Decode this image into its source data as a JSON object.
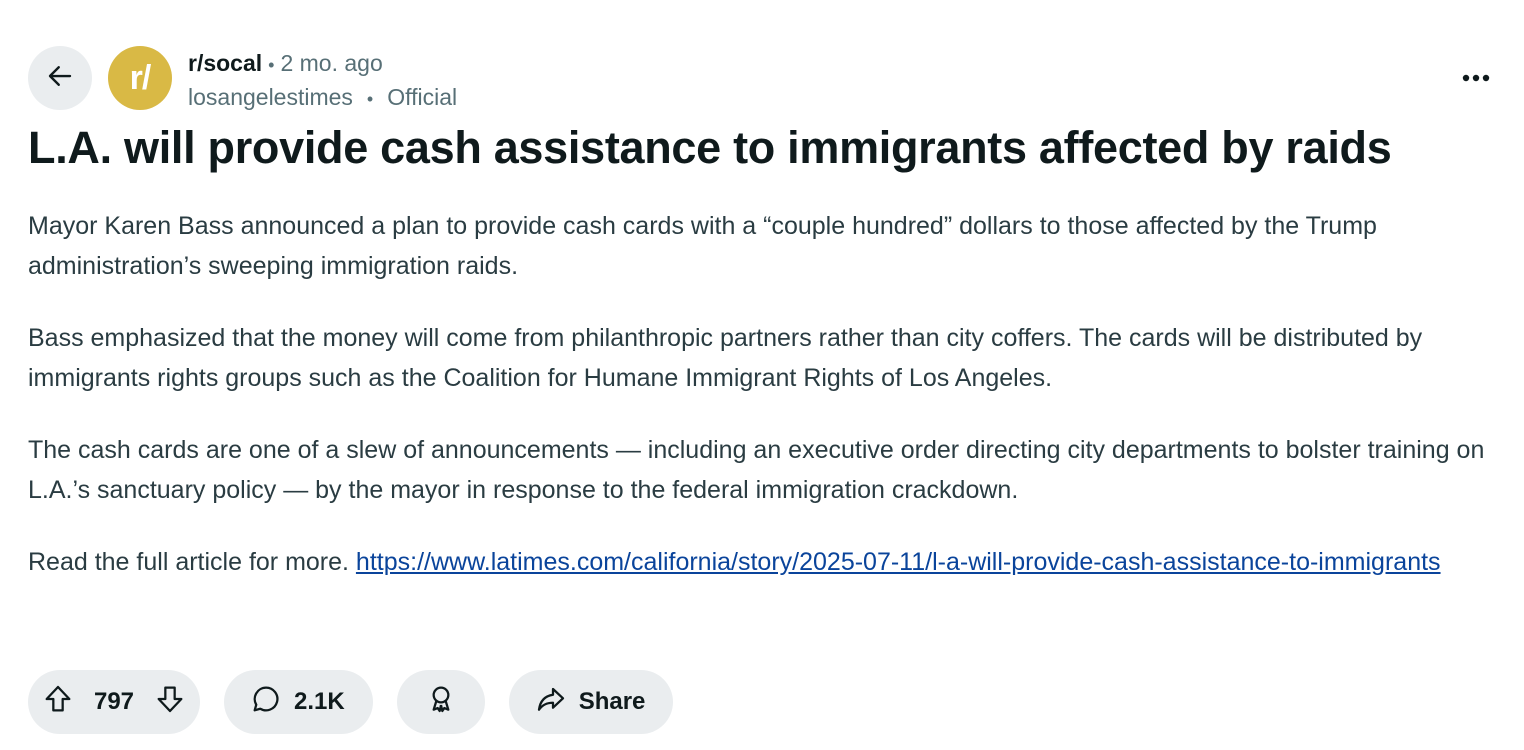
{
  "header": {
    "avatar_text": "r/",
    "subreddit": "r/socal",
    "separator": "•",
    "time_ago": "2 mo. ago",
    "author": "losangelestimes",
    "flair": "Official"
  },
  "post": {
    "title": "L.A. will provide cash assistance to immigrants affected by raids",
    "paragraphs": [
      "Mayor Karen Bass announced a plan to provide cash cards with a “couple hundred” dollars to those affected by the Trump administration’s sweeping immigration raids.",
      "Bass emphasized that the money will come from philanthropic partners rather than city coffers. The cards will be distributed by immigrants rights groups such as the Coalition for Humane Immigrant Rights of Los Angeles.",
      "The cash cards are one of a slew of announcements — including an executive order directing city departments to bolster training on L.A.’s sanctuary policy — by the mayor in response to the federal immigration crackdown."
    ],
    "read_more_text": "Read the full article for more. ",
    "link_text": "https://www.latimes.com/california/story/2025-07-11/l-a-will-provide-cash-assistance-to-immigrants"
  },
  "actions": {
    "vote_count": "797",
    "comment_count": "2.1K",
    "share_label": "Share"
  },
  "colors": {
    "avatar_bg": "#d9b945",
    "pill_bg": "#eaedef",
    "link": "#0a449b",
    "meta_gray": "#576f76"
  },
  "icons": [
    "back-arrow-icon",
    "more-options-icon",
    "upvote-icon",
    "downvote-icon",
    "comment-icon",
    "award-icon",
    "share-icon"
  ]
}
